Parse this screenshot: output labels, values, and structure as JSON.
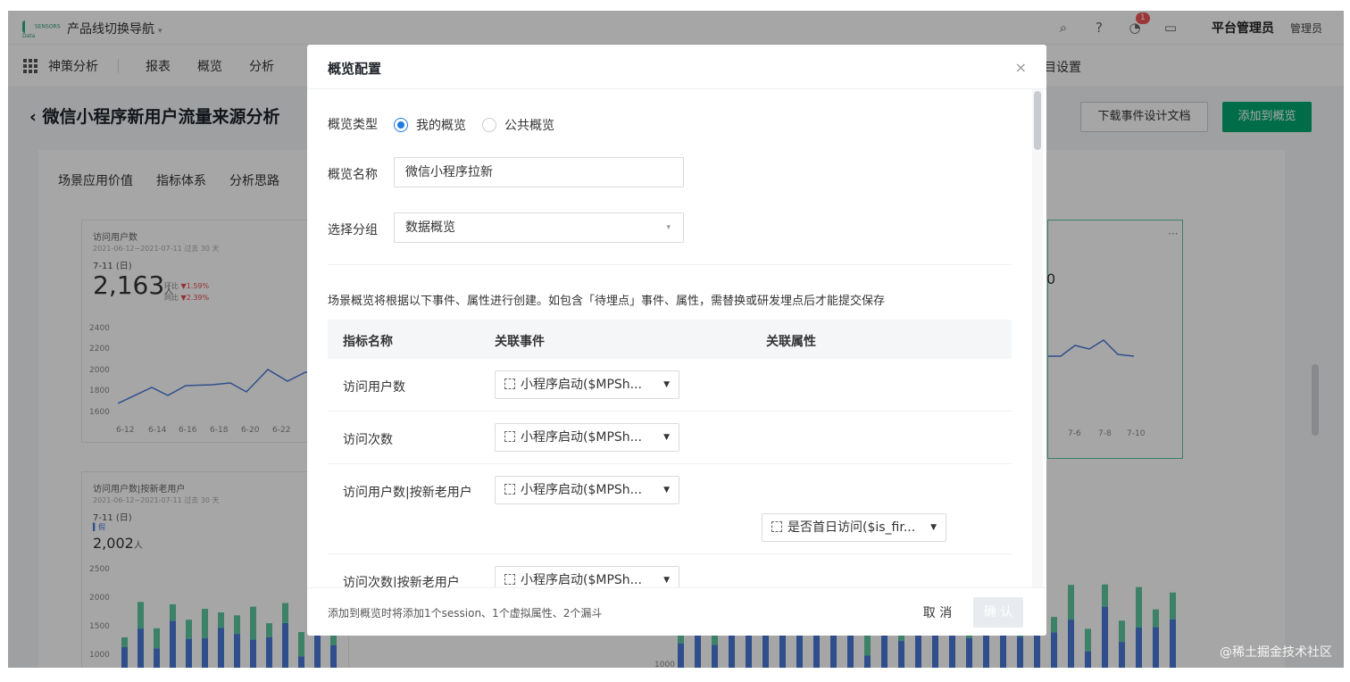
{
  "topbar": {
    "logo_text": "SENSORS Data",
    "product_switch": "产品线切换导航",
    "notification_count": "1",
    "admin_name": "平台管理员",
    "admin_role": "管理员"
  },
  "navbar": {
    "product": "神策分析",
    "items": [
      "报表",
      "概览",
      "分析"
    ],
    "right_item": "目设置"
  },
  "page": {
    "title": "微信小程序新用户流量来源分析",
    "download_button": "下载事件设计文档",
    "add_button": "添加到概览",
    "tabs": [
      "场景应用价值",
      "指标体系",
      "分析思路"
    ]
  },
  "card1": {
    "title": "访问用户数",
    "subtitle": "2021-06-12~2021-07-11 过去 30 天",
    "date": "7-11 (日)",
    "value": "2,163",
    "unit": "人",
    "cmp1": "环比",
    "cmp1_val": "▼1.59%",
    "cmp2": "同比",
    "cmp2_val": "▼2.39%",
    "yticks": [
      "2400",
      "2200",
      "2000",
      "1800",
      "1600"
    ],
    "xticks": [
      "6-12",
      "6-14",
      "6-16",
      "6-18",
      "6-20",
      "6-22"
    ]
  },
  "card2": {
    "title": "访问用户数|按新老用户",
    "subtitle": "2021-06-12~2021-07-11 过去 30 天",
    "date": "7-11 (日)",
    "legend": "假",
    "value": "2,002",
    "unit": "人",
    "yticks": [
      "2500",
      "2000",
      "1500",
      "1000"
    ]
  },
  "card3": {
    "partial_value": "0",
    "xticks": [
      "7-6",
      "7-8",
      "7-10"
    ],
    "ytick": "1000"
  },
  "watermark": "@稀土掘金技术社区",
  "modal": {
    "title": "概览配置",
    "close": "×",
    "type_label": "概览类型",
    "type_options": [
      "我的概览",
      "公共概览"
    ],
    "type_selected": "我的概览",
    "name_label": "概览名称",
    "name_value": "微信小程序拉新",
    "group_label": "选择分组",
    "group_value": "数据概览",
    "notice": "场景概览将根据以下事件、属性进行创建。如包含「待埋点」事件、属性，需替换或研发埋点后才能提交保存",
    "table_headers": [
      "指标名称",
      "关联事件",
      "关联属性"
    ],
    "rows": [
      {
        "name": "访问用户数",
        "event": "小程序启动($MPSh...",
        "property": ""
      },
      {
        "name": "访问次数",
        "event": "小程序启动($MPSh...",
        "property": ""
      },
      {
        "name": "访问用户数|按新老用户",
        "event": "小程序启动($MPSh...",
        "property": "是否首日访问($is_fir..."
      },
      {
        "name": "访问次数|按新老用户",
        "event": "小程序启动($MPSh...",
        "property": ""
      }
    ],
    "footer_note": "添加到概览时将添加1个session、1个虚拟属性、2个漏斗",
    "cancel": "取 消",
    "confirm": "确 认"
  },
  "colors": {
    "primary_green": "#00a870",
    "radio_blue": "#1f7ae0",
    "bar_green": "#5cc7a0",
    "bar_blue": "#4a78d8"
  }
}
